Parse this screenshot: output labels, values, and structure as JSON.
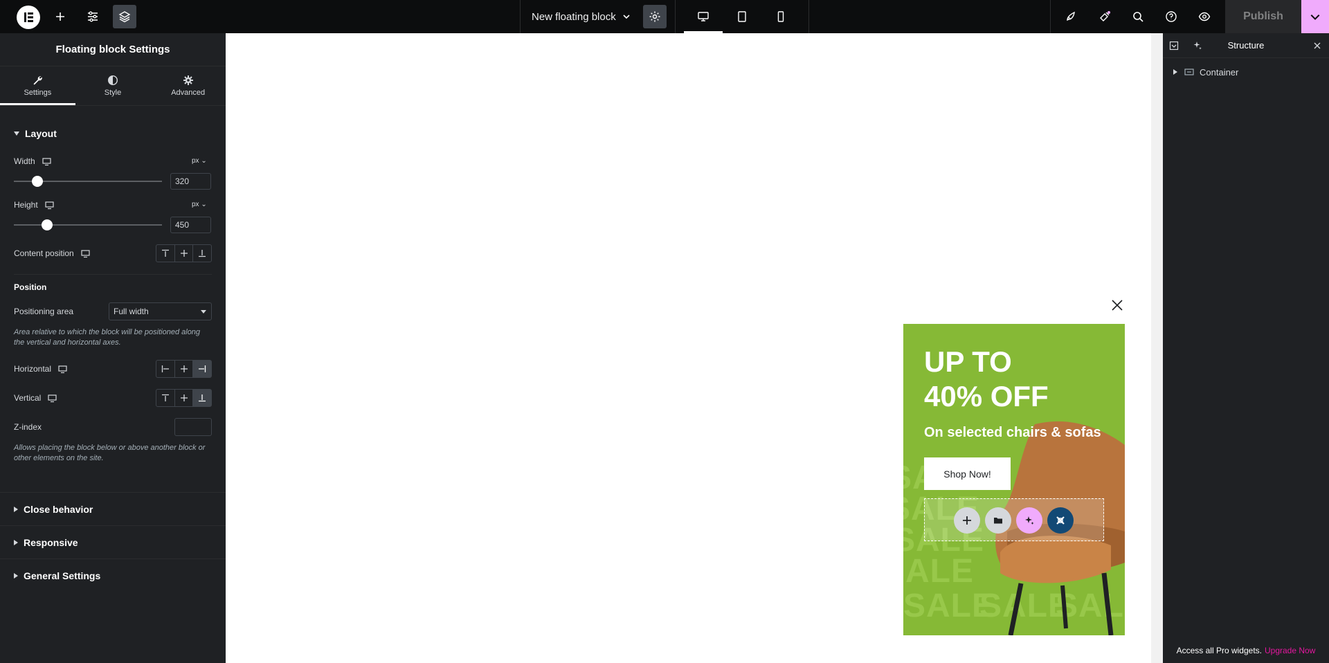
{
  "topbar": {
    "document_title": "New floating block",
    "publish_label": "Publish",
    "icons": [
      "elementor-logo",
      "add-icon",
      "sliders-icon",
      "layers-icon",
      "gear-icon",
      "desktop-icon",
      "tablet-icon",
      "mobile-icon",
      "rocket-icon",
      "whats-new-icon",
      "search-icon",
      "help-icon",
      "eye-icon",
      "chevron-down-icon"
    ]
  },
  "panel": {
    "title": "Floating block Settings",
    "tabs": [
      {
        "label": "Settings",
        "icon": "wrench-icon"
      },
      {
        "label": "Style",
        "icon": "contrast-icon"
      },
      {
        "label": "Advanced",
        "icon": "gear-icon"
      }
    ],
    "layout": {
      "title": "Layout",
      "width": {
        "label": "Width",
        "unit": "px",
        "value": "320",
        "slider_fraction": 0.12
      },
      "height": {
        "label": "Height",
        "unit": "px",
        "value": "450",
        "slider_fraction": 0.18
      },
      "content_position": {
        "label": "Content position"
      },
      "position_title": "Position",
      "positioning_area": {
        "label": "Positioning area",
        "value": "Full width"
      },
      "positioning_help": "Area relative to which the block will be positioned along the vertical and horizontal axes.",
      "horizontal": {
        "label": "Horizontal"
      },
      "vertical": {
        "label": "Vertical"
      },
      "zindex": {
        "label": "Z-index",
        "value": ""
      },
      "zindex_help": "Allows placing the block below or above another block or other elements on the site."
    },
    "sections": [
      "Close behavior",
      "Responsive",
      "General Settings"
    ]
  },
  "promo": {
    "headline_line1": "UP TO",
    "headline_line2": "40% OFF",
    "subline": "On selected chairs & sofas",
    "button_label": "Shop Now!",
    "background_word": "SALE",
    "colors": {
      "background": "#86b936",
      "chair": "#b8743d"
    }
  },
  "structure": {
    "title": "Structure",
    "items": [
      {
        "label": "Container"
      }
    ],
    "footer_text": "Access all Pro widgets.",
    "footer_link": "Upgrade Now"
  }
}
